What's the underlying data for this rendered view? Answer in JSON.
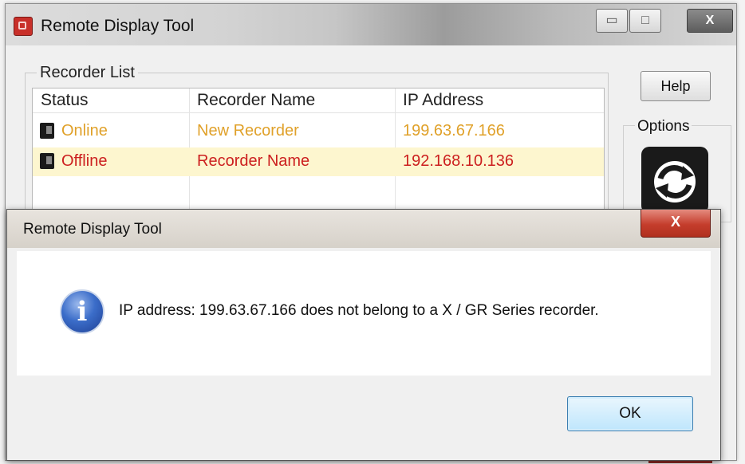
{
  "main_window": {
    "title": "Remote Display Tool",
    "controls": {
      "minimize": "▭",
      "maximize": "□",
      "close": "X"
    }
  },
  "recorder_list": {
    "legend": "Recorder List",
    "columns": [
      "Status",
      "Recorder Name",
      "IP Address"
    ],
    "rows": [
      {
        "status": "Online",
        "name": "New Recorder",
        "ip": "199.63.67.166",
        "color": "#e0a12a"
      },
      {
        "status": "Offline",
        "name": "Recorder Name",
        "ip": "192.168.10.136",
        "color": "#cc1f1f"
      }
    ]
  },
  "side_panel": {
    "help_label": "Help",
    "options_label": "Options",
    "refresh_icon": "refresh-icon"
  },
  "dialog": {
    "title": "Remote Display Tool",
    "close_label": "X",
    "icon": "info-icon",
    "icon_glyph": "i",
    "message": "IP address: 199.63.67.166 does not belong to a X / GR Series recorder.",
    "ok_label": "OK"
  }
}
